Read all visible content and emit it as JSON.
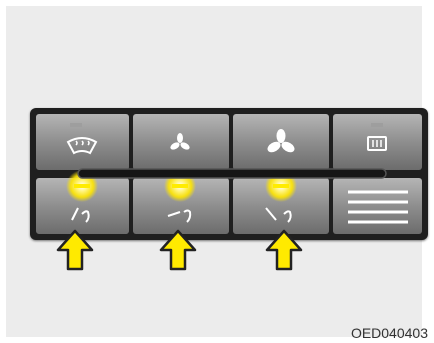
{
  "figure": {
    "caption": "OED040403"
  },
  "panel": {
    "top_row": [
      {
        "name": "front-defrost-button",
        "icon": "windshield-defrost-icon",
        "indicator": "led-off"
      },
      {
        "name": "fan-low-button",
        "icon": "fan-small-icon"
      },
      {
        "name": "fan-high-button",
        "icon": "fan-large-icon"
      },
      {
        "name": "rear-defrost-button",
        "icon": "rear-window-defrost-icon",
        "indicator": "led-off"
      }
    ],
    "bottom_row": [
      {
        "name": "mode-face-button",
        "icon": "airflow-face-icon",
        "indicator": "led-on",
        "highlighted": true
      },
      {
        "name": "mode-bilevel-button",
        "icon": "airflow-bilevel-icon",
        "indicator": "led-on",
        "highlighted": true
      },
      {
        "name": "mode-floor-button",
        "icon": "airflow-floor-icon",
        "indicator": "led-on",
        "highlighted": true
      },
      {
        "name": "vent-grille",
        "icon": "grille-lines-icon"
      }
    ],
    "colors": {
      "panel": "#1f1f1f",
      "button_face": "#8d8d8d",
      "led_glow": "#ffe600",
      "arrow": "#ffea00"
    }
  }
}
